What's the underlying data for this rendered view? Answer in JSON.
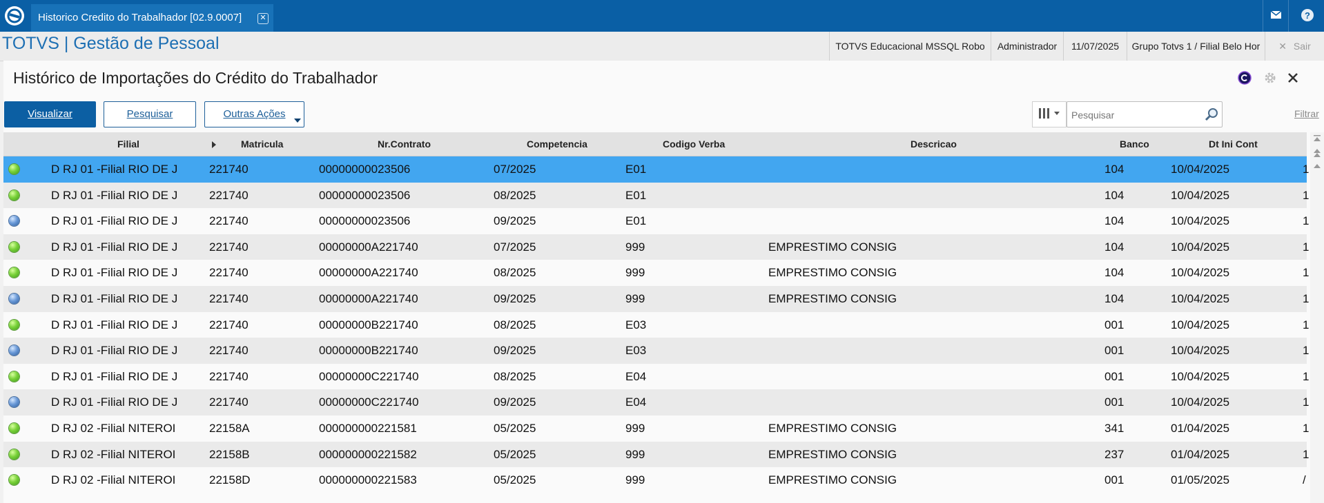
{
  "topbar": {
    "tab_title": "Historico Credito do Trabalhador [02.9.0007]",
    "tab_close": "✕"
  },
  "header": {
    "brand": "TOTVS | Gestão de Pessoal",
    "environment": "TOTVS Educacional MSSQL Robo",
    "user": "Administrador",
    "date": "11/07/2025",
    "branch": "Grupo Totvs 1 / Filial Belo Hor",
    "logout_icon": "✕",
    "logout_label": "Sair"
  },
  "page": {
    "title": "Histórico de Importações do Crédito do Trabalhador"
  },
  "toolbar": {
    "visualizar": "Visualizar",
    "pesquisar": "Pesquisar",
    "outras_acoes": "Outras Ações",
    "search_placeholder": "Pesquisar",
    "filtrar": "Filtrar"
  },
  "grid": {
    "columns": [
      "Filial",
      "Matricula",
      "Nr.Contrato",
      "Competencia",
      "Codigo Verba",
      "Descricao",
      "Banco",
      "Dt Ini Cont"
    ],
    "rows": [
      {
        "status": "green",
        "filial": "D RJ 01 -Filial RIO DE J",
        "matricula": "221740",
        "contrato": "00000000023506",
        "competencia": "07/2025",
        "verba": "E01",
        "descricao": "",
        "banco": "104",
        "dtini": "10/04/2025",
        "extra": "1"
      },
      {
        "status": "green",
        "filial": "D RJ 01 -Filial RIO DE J",
        "matricula": "221740",
        "contrato": "00000000023506",
        "competencia": "08/2025",
        "verba": "E01",
        "descricao": "",
        "banco": "104",
        "dtini": "10/04/2025",
        "extra": "1"
      },
      {
        "status": "blue",
        "filial": "D RJ 01 -Filial RIO DE J",
        "matricula": "221740",
        "contrato": "00000000023506",
        "competencia": "09/2025",
        "verba": "E01",
        "descricao": "",
        "banco": "104",
        "dtini": "10/04/2025",
        "extra": "1"
      },
      {
        "status": "green",
        "filial": "D RJ 01 -Filial RIO DE J",
        "matricula": "221740",
        "contrato": "00000000A221740",
        "competencia": "07/2025",
        "verba": "999",
        "descricao": "EMPRESTIMO CONSIG",
        "banco": "104",
        "dtini": "10/04/2025",
        "extra": "1"
      },
      {
        "status": "green",
        "filial": "D RJ 01 -Filial RIO DE J",
        "matricula": "221740",
        "contrato": "00000000A221740",
        "competencia": "08/2025",
        "verba": "999",
        "descricao": "EMPRESTIMO CONSIG",
        "banco": "104",
        "dtini": "10/04/2025",
        "extra": "1"
      },
      {
        "status": "blue",
        "filial": "D RJ 01 -Filial RIO DE J",
        "matricula": "221740",
        "contrato": "00000000A221740",
        "competencia": "09/2025",
        "verba": "999",
        "descricao": "EMPRESTIMO CONSIG",
        "banco": "104",
        "dtini": "10/04/2025",
        "extra": "1"
      },
      {
        "status": "green",
        "filial": "D RJ 01 -Filial RIO DE J",
        "matricula": "221740",
        "contrato": "00000000B221740",
        "competencia": "08/2025",
        "verba": "E03",
        "descricao": "",
        "banco": "001",
        "dtini": "10/04/2025",
        "extra": "1"
      },
      {
        "status": "blue",
        "filial": "D RJ 01 -Filial RIO DE J",
        "matricula": "221740",
        "contrato": "00000000B221740",
        "competencia": "09/2025",
        "verba": "E03",
        "descricao": "",
        "banco": "001",
        "dtini": "10/04/2025",
        "extra": "1"
      },
      {
        "status": "green",
        "filial": "D RJ 01 -Filial RIO DE J",
        "matricula": "221740",
        "contrato": "00000000C221740",
        "competencia": "08/2025",
        "verba": "E04",
        "descricao": "",
        "banco": "001",
        "dtini": "10/04/2025",
        "extra": "1"
      },
      {
        "status": "blue",
        "filial": "D RJ 01 -Filial RIO DE J",
        "matricula": "221740",
        "contrato": "00000000C221740",
        "competencia": "09/2025",
        "verba": "E04",
        "descricao": "",
        "banco": "001",
        "dtini": "10/04/2025",
        "extra": "1"
      },
      {
        "status": "green",
        "filial": "D RJ 02 -Filial NITEROI",
        "matricula": "22158A",
        "contrato": "000000000221581",
        "competencia": "05/2025",
        "verba": "999",
        "descricao": "EMPRESTIMO CONSIG",
        "banco": "341",
        "dtini": "01/04/2025",
        "extra": "1"
      },
      {
        "status": "green",
        "filial": "D RJ 02 -Filial NITEROI",
        "matricula": "22158B",
        "contrato": "000000000221582",
        "competencia": "05/2025",
        "verba": "999",
        "descricao": "EMPRESTIMO CONSIG",
        "banco": "237",
        "dtini": "01/04/2025",
        "extra": "1"
      },
      {
        "status": "green",
        "filial": "D RJ 02 -Filial NITEROI",
        "matricula": "22158D",
        "contrato": "000000000221583",
        "competencia": "05/2025",
        "verba": "999",
        "descricao": "EMPRESTIMO CONSIG",
        "banco": "001",
        "dtini": "01/05/2025",
        "extra": "/"
      }
    ]
  },
  "colors": {
    "topbar": "#0a5fa5",
    "selected_row": "#42a6f0",
    "brand": "#1d6fb3",
    "status_green": "#7ad23a",
    "status_blue": "#6b9ad8"
  }
}
